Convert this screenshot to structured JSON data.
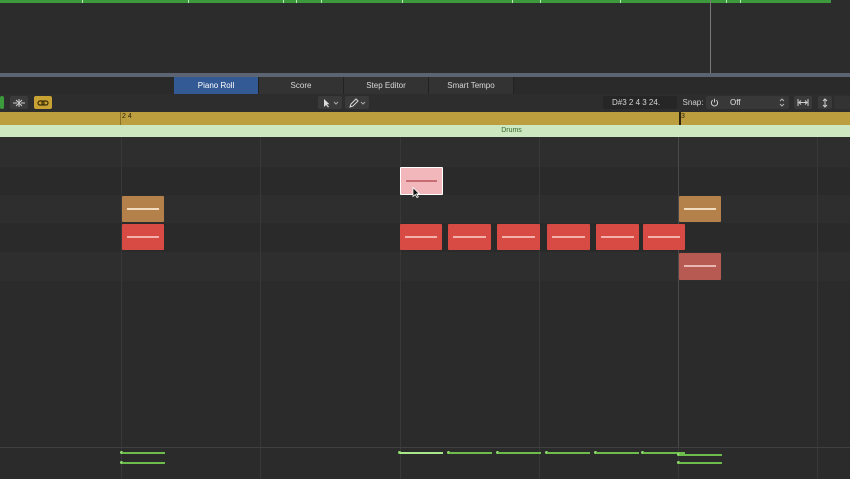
{
  "tabs": [
    {
      "label": "Piano Roll",
      "active": true
    },
    {
      "label": "Score",
      "active": false
    },
    {
      "label": "Step Editor",
      "active": false
    },
    {
      "label": "Smart Tempo",
      "active": false
    }
  ],
  "toolbar": {
    "position_readout": "D#3   2 4 3 24.",
    "snap_label": "Snap:",
    "snap_value": "Off",
    "icons": [
      "filter-icon",
      "midi-in-icon",
      "link-icon",
      "pointer-tool-icon",
      "pencil-tool-icon",
      "power-icon",
      "fit-horizontal-icon",
      "fit-vertical-icon"
    ]
  },
  "ruler": {
    "labels": [
      "2 4",
      "3"
    ]
  },
  "region": {
    "name": "Drums"
  },
  "colors": {
    "tan_note": "#b5814a",
    "red_note": "#d84a44",
    "pink_selected": "#f2b7bb",
    "dark_red_note": "#b75a52",
    "ruler": "#bc9e3f",
    "region": "#cde7c0",
    "velocity": "#6dbd4d",
    "active_tab": "#345a95"
  }
}
